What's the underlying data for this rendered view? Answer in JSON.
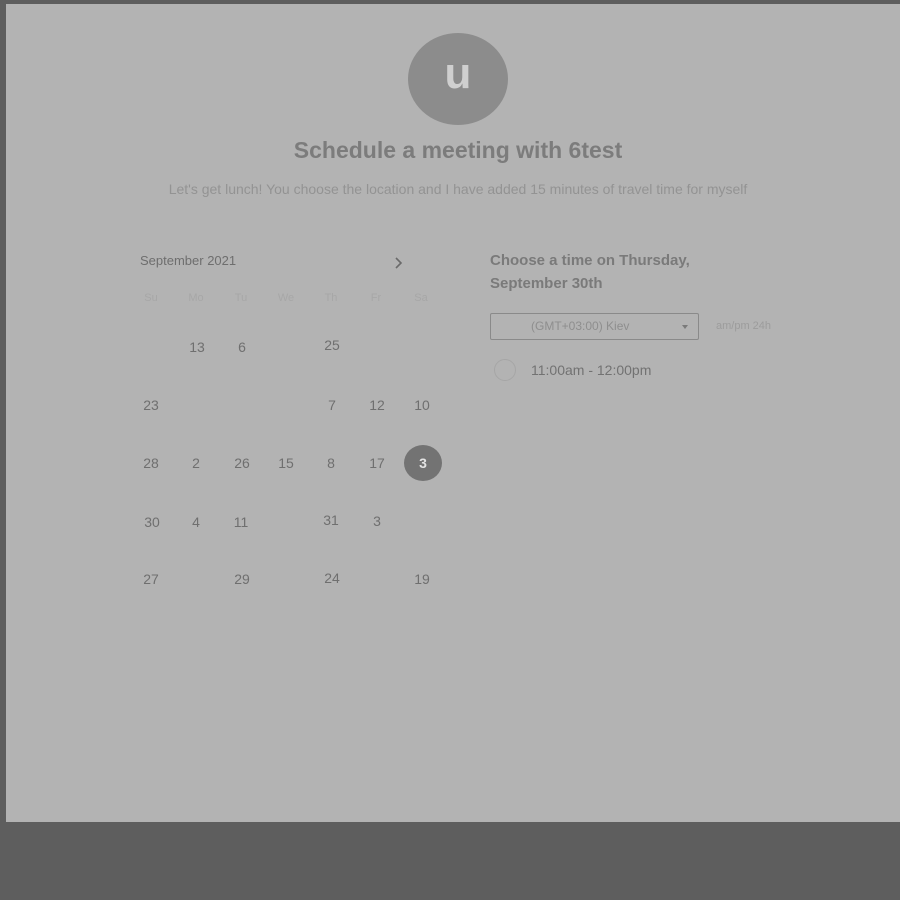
{
  "avatar": {
    "initial": "u"
  },
  "header": {
    "title": "Schedule a meeting with 6test",
    "subtitle": "Let's get lunch! You choose the location and I have added 15 minutes of travel time for myself"
  },
  "calendar": {
    "month_label": "September 2021",
    "next_icon": "chevron-right-icon",
    "weekday_headers": [
      "Su",
      "Mo",
      "Tu",
      "We",
      "Th",
      "Fr",
      "Sa"
    ],
    "days": [
      "13",
      "6",
      "25",
      "23",
      "7",
      "12",
      "10",
      "28",
      "2",
      "26",
      "15",
      "8",
      "17",
      "3",
      "30",
      "4",
      "11",
      "31",
      "3",
      "27",
      "29",
      "24",
      "19"
    ],
    "selected_day": "3"
  },
  "time_picker": {
    "heading": "Choose a time on Thursday, September 30th",
    "timezone": "(GMT+03:00) Kiev",
    "format_toggle": "am/pm 24h",
    "slots": [
      {
        "label": "11:00am - 12:00pm"
      }
    ]
  }
}
